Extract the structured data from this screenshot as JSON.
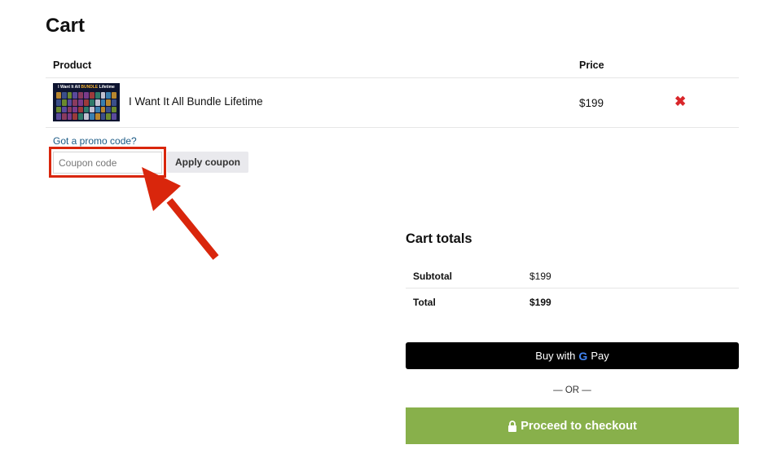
{
  "page": {
    "title": "Cart"
  },
  "cart_table": {
    "headers": {
      "product": "Product",
      "price": "Price"
    },
    "items": [
      {
        "thumbnail": {
          "title_prefix": "I Want It All",
          "title_accent": "BUNDLE",
          "title_suffix": "Lifetime"
        },
        "name": "I Want It All Bundle Lifetime",
        "price": "$199",
        "remove_symbol": "✖"
      }
    ]
  },
  "coupon": {
    "promo_link": "Got a promo code?",
    "placeholder": "Coupon code",
    "value": "",
    "apply_label": "Apply coupon"
  },
  "totals": {
    "title": "Cart totals",
    "rows": [
      {
        "label": "Subtotal",
        "value": "$199"
      },
      {
        "label": "Total",
        "value": "$199"
      }
    ]
  },
  "payment": {
    "gpay_prefix": "Buy with",
    "gpay_g": "G",
    "gpay_suffix": "Pay",
    "or_separator": "— OR —",
    "checkout_label": "Proceed to checkout"
  },
  "colors": {
    "annotation_red": "#d9260c",
    "remove_red": "#d9262a",
    "link_blue": "#1c5b86",
    "checkout_green": "#88b04b",
    "gpay_black": "#000000"
  }
}
